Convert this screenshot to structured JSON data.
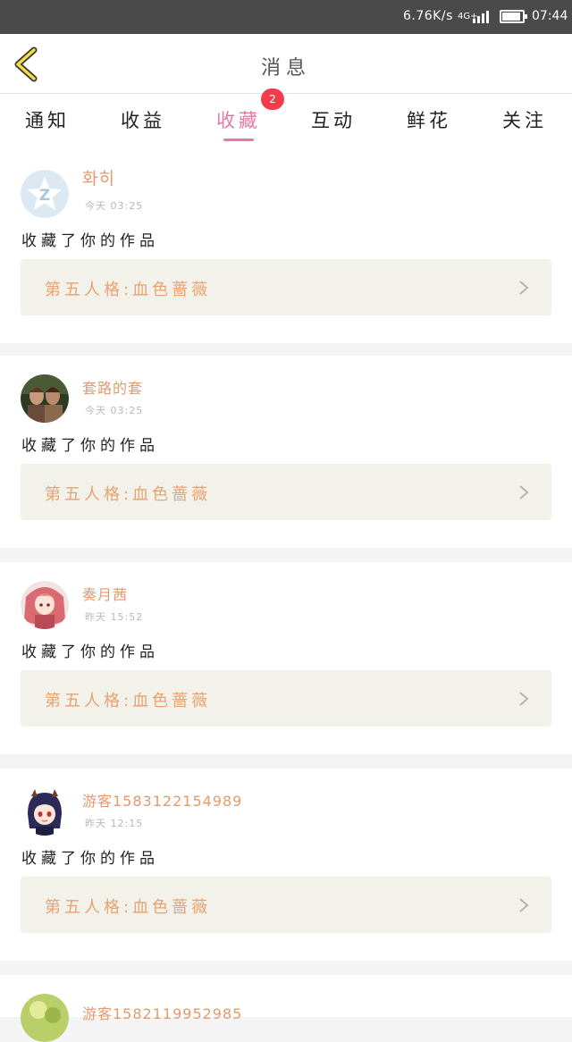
{
  "status": {
    "speed": "6.76K/s",
    "network": "4G+",
    "time": "07:44",
    "battery_level": 0.9,
    "signal_bars": 4
  },
  "header": {
    "title": "消息",
    "back_icon": "chevron-left-icon"
  },
  "tabs": [
    {
      "label": "通知",
      "active": false
    },
    {
      "label": "收益",
      "active": false
    },
    {
      "label": "收藏",
      "active": true,
      "badge": "2"
    },
    {
      "label": "互动",
      "active": false
    },
    {
      "label": "鲜花",
      "active": false
    },
    {
      "label": "关注",
      "active": false
    }
  ],
  "colors": {
    "accent": "#e27aa5",
    "name": "#e39a6c",
    "work_title": "#e8a271",
    "badge": "#f33b4a"
  },
  "items": [
    {
      "name": "화히",
      "time": "今天  03:25",
      "action": "收藏了你的作品",
      "work": "第五人格:血色蔷薇",
      "avatar": "qq-avatar-icon"
    },
    {
      "name": "套路的套",
      "time": "今天  03:25",
      "action": "收藏了你的作品",
      "work": "第五人格:血色蔷薇",
      "avatar": "photo-avatar"
    },
    {
      "name": "奏月茜",
      "time": "昨天  15:52",
      "action": "收藏了你的作品",
      "work": "第五人格:血色蔷薇",
      "avatar": "anime-avatar"
    },
    {
      "name": "游客1583122154989",
      "time": "昨天  12:15",
      "action": "收藏了你的作品",
      "work": "第五人格:血色蔷薇",
      "avatar": "anime-avatar"
    },
    {
      "name": "游客1582119952985",
      "time": "",
      "action": "",
      "work": "",
      "avatar": "flower-avatar"
    }
  ]
}
